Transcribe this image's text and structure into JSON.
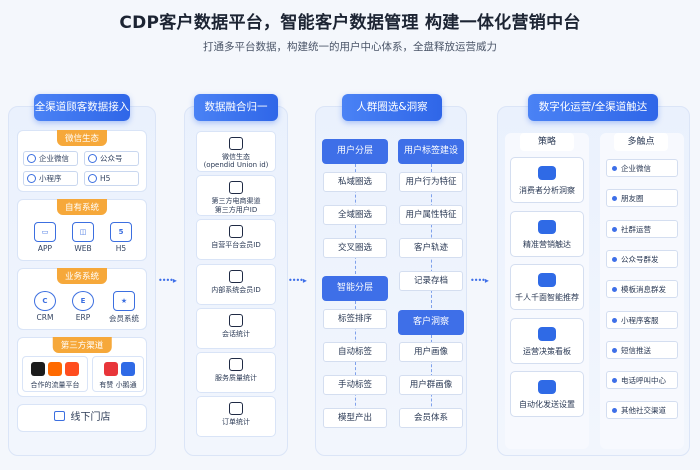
{
  "title": "CDP客户数据平台，智能客户数据管理 构建一体化营销中台",
  "subtitle": "打通多平台数据，构建统一的用户中心体系，全盘释放运营威力",
  "colors": {
    "accent": "#3e6fe8",
    "tag": "#f6a83a",
    "panel": "#eaf1fd"
  },
  "col1": {
    "header": "全渠道顾客数据接入",
    "wechat": {
      "tag": "微信生态",
      "items": [
        "企业微信",
        "公众号",
        "小程序",
        "H5"
      ]
    },
    "own": {
      "tag": "自有系统",
      "items": [
        "APP",
        "WEB",
        "H5"
      ]
    },
    "biz": {
      "tag": "业务系统",
      "items": [
        "CRM",
        "ERP",
        "会员系统"
      ]
    },
    "third": {
      "tag": "第三方渠道",
      "items": [
        "合作的流量平台",
        "有赞 小鹅通"
      ]
    },
    "offline": "线下门店"
  },
  "col2": {
    "header": "数据融合归一",
    "items": [
      [
        "微信生态",
        "(opendid Union id)"
      ],
      [
        "第三方电商渠道",
        "第三方用户ID"
      ],
      [
        "自营平台会员ID"
      ],
      [
        "内部系统会员ID"
      ],
      [
        "会话统计"
      ],
      [
        "服务质量统计"
      ],
      [
        "订单统计"
      ]
    ],
    "icons": [
      "wechat-id-icon",
      "ecommerce-id-icon",
      "platform-member-icon",
      "internal-member-icon",
      "session-stats-icon",
      "service-quality-icon",
      "order-stats-icon"
    ]
  },
  "col3": {
    "header": "人群圈选&洞察",
    "layer": {
      "title": "用户分层",
      "items": [
        "私域圈选",
        "全域圈选",
        "交叉圈选"
      ]
    },
    "tagbuild": {
      "title": "用户标签建设",
      "items": [
        "用户行为特征",
        "用户属性特征",
        "客户轨迹",
        "记录存档"
      ]
    },
    "smart": {
      "title": "智能分层",
      "items": [
        "标签排序",
        "自动标签",
        "手动标签",
        "模型产出"
      ]
    },
    "insight": {
      "title": "客户洞察",
      "items": [
        "用户画像",
        "用户群画像",
        "会员体系"
      ]
    }
  },
  "col4": {
    "header": "数字化运营/全渠道触达",
    "strategy": {
      "title": "策略",
      "items": [
        "消费者分析洞察",
        "精准营销触达",
        "千人千面智能推荐",
        "运营决策看板",
        "自动化发送设置"
      ]
    },
    "touch": {
      "title": "多触点",
      "items": [
        "企业微信",
        "朋友圈",
        "社群运营",
        "公众号群发",
        "模板消息群发",
        "小程序客服",
        "短信推送",
        "电话呼叫中心",
        "其他社交渠道"
      ]
    }
  },
  "arrow": "••••▸"
}
